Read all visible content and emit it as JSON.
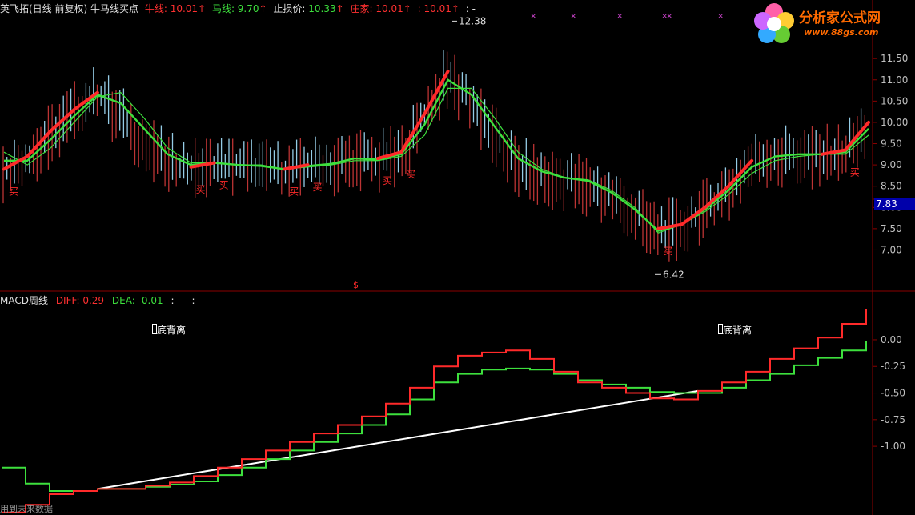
{
  "colors": {
    "background": "#000000",
    "frame": "#8b0000",
    "red": "#ff2a2a",
    "green": "#3de03d",
    "white": "#ffffff",
    "cyan": "#a6e3ff",
    "axis_text": "#c0c0c0",
    "purple_marker": "#cc44cc",
    "price_tag_bg": "#0000aa"
  },
  "header": {
    "title": "英飞拓(日线 前复权) 牛马线买点",
    "niu_label": "牛线: ",
    "niu_value": "10.01",
    "ma_label": "马线: ",
    "ma_value": "9.70",
    "stop_label": "止损价: ",
    "stop_value": "10.33",
    "zhuang_label": "庄家: ",
    "zhuang_value": "10.01",
    "extra_value": ": 10.01",
    "dash": ": -",
    "arrow": "↑"
  },
  "sub_header": {
    "title": "MACD周线",
    "diff_label": "DIFF: ",
    "diff_value": "0.29",
    "dea_label": "DEA: ",
    "dea_value": "-0.01",
    "dash1": ": -",
    "dash2": ": -"
  },
  "price_axis": {
    "ticks": [
      "11.50",
      "11.00",
      "10.50",
      "10.00",
      "9.50",
      "9.00",
      "8.50",
      "8.00",
      "7.50",
      "7.00"
    ],
    "current_price": "7.83"
  },
  "macd_axis": {
    "ticks": [
      "0.00",
      "-0.25",
      "-0.50",
      "-0.75",
      "-1.00"
    ]
  },
  "annotations": {
    "high_label": "12.38",
    "low_label": "6.42",
    "buy_label": "买",
    "divergence_label": "底背离",
    "dollar_marker": "$",
    "purple_marker": "×"
  },
  "logo": {
    "brand": "分析家公式网",
    "url": "www.88gs.com"
  },
  "footer": {
    "text": "用到未来数据"
  },
  "chart_data": [
    {
      "type": "line",
      "title": "英飞拓(日线 前复权) 牛马线买点",
      "ylim": [
        6.2,
        12.5
      ],
      "series": [
        {
          "name": "牛线",
          "color": "#ff2a2a",
          "values": [
            8.9,
            9.2,
            9.8,
            10.3,
            10.7,
            10.2,
            9.6,
            9.1,
            8.95,
            9.05,
            9.0,
            8.95,
            8.9,
            9.0,
            9.05,
            9.2,
            9.15,
            9.3,
            10.2,
            11.2,
            10.5,
            9.7,
            9.0,
            8.8,
            8.7,
            8.6,
            8.3,
            7.9,
            7.5,
            7.6,
            8.0,
            8.5,
            9.1,
            9.3,
            9.3,
            9.25,
            9.35,
            10.0
          ]
        },
        {
          "name": "马线",
          "color": "#3de03d",
          "values": [
            9.3,
            9.0,
            9.4,
            10.0,
            10.6,
            10.7,
            10.1,
            9.4,
            9.05,
            9.05,
            9.0,
            9.0,
            8.9,
            8.95,
            9.0,
            9.1,
            9.1,
            9.2,
            9.7,
            10.8,
            10.8,
            10.1,
            9.3,
            8.9,
            8.7,
            8.65,
            8.4,
            8.0,
            7.4,
            7.6,
            7.9,
            8.3,
            8.8,
            9.1,
            9.2,
            9.25,
            9.25,
            9.7
          ]
        }
      ],
      "high": 12.38,
      "low": 6.42
    },
    {
      "type": "line",
      "title": "MACD周线",
      "ylim": [
        -1.6,
        0.3
      ],
      "series": [
        {
          "name": "DIFF",
          "color": "#ff2a2a",
          "values": [
            -1.62,
            -1.55,
            -1.45,
            -1.42,
            -1.4,
            -1.4,
            -1.37,
            -1.34,
            -1.28,
            -1.2,
            -1.12,
            -1.04,
            -0.96,
            -0.88,
            -0.8,
            -0.72,
            -0.6,
            -0.45,
            -0.25,
            -0.15,
            -0.12,
            -0.1,
            -0.18,
            -0.3,
            -0.4,
            -0.45,
            -0.5,
            -0.55,
            -0.56,
            -0.48,
            -0.4,
            -0.3,
            -0.18,
            -0.08,
            0.02,
            0.15,
            0.29
          ]
        },
        {
          "name": "DEA",
          "color": "#3de03d",
          "values": [
            -1.2,
            -1.35,
            -1.42,
            -1.42,
            -1.4,
            -1.4,
            -1.38,
            -1.36,
            -1.33,
            -1.27,
            -1.2,
            -1.12,
            -1.04,
            -0.96,
            -0.88,
            -0.8,
            -0.7,
            -0.56,
            -0.4,
            -0.32,
            -0.28,
            -0.27,
            -0.28,
            -0.32,
            -0.38,
            -0.42,
            -0.45,
            -0.49,
            -0.5,
            -0.5,
            -0.45,
            -0.38,
            -0.32,
            -0.24,
            -0.17,
            -0.1,
            -0.01
          ]
        }
      ]
    }
  ]
}
